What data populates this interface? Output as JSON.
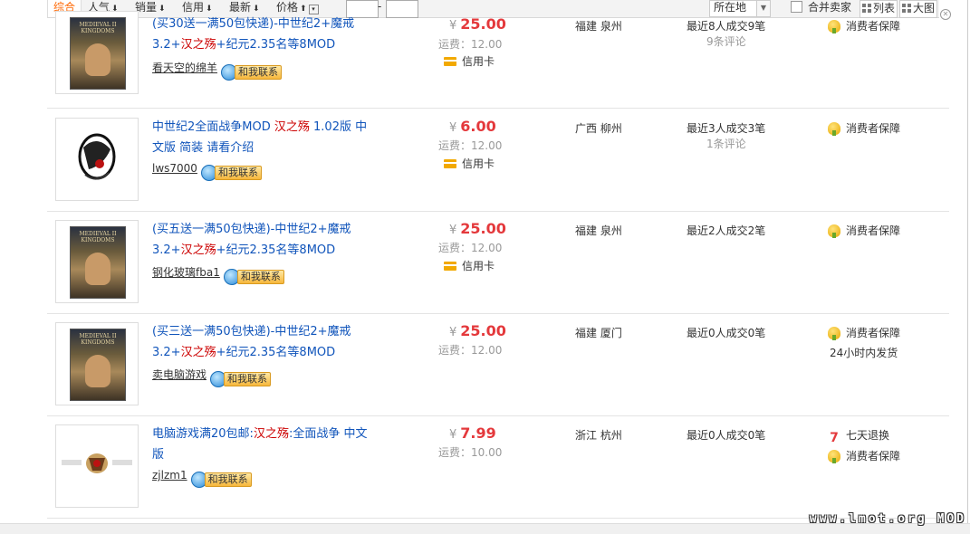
{
  "sortbar": {
    "active": "综合",
    "items": [
      {
        "label": "人气",
        "arrow": "⬇"
      },
      {
        "label": "销量",
        "arrow": "⬇"
      },
      {
        "label": "信用",
        "arrow": "⬇"
      },
      {
        "label": "最新",
        "arrow": "⬇"
      },
      {
        "label": "价格",
        "arrow": "⬆"
      }
    ],
    "price_dash": "-",
    "location_label": "所在地",
    "merge_label": "合并卖家",
    "view_list": "列表",
    "view_grid": "大图"
  },
  "contact_label": "和我联系",
  "price_currency": "¥",
  "listings": [
    {
      "title_parts": [
        {
          "t": "(买30送一满50包快递)-中世纪2+魔戒3.2+",
          "kw": false
        },
        {
          "t": "汉之殇",
          "kw": true
        },
        {
          "t": "+纪元2.35名等8MOD",
          "kw": false
        }
      ],
      "seller": "看天空的绵羊",
      "price": "25.00",
      "shipping": "运费：12.00",
      "payment": "信用卡",
      "location": "福建 泉州",
      "deals": "最近8人成交9笔",
      "reviews": "9条评论",
      "guarantee": "消费者保障",
      "extra": ""
    },
    {
      "title_parts": [
        {
          "t": "中世纪2全面战争MOD ",
          "kw": false
        },
        {
          "t": "汉之殇",
          "kw": true
        },
        {
          "t": " 1.02版 中文版 简装 请看介绍",
          "kw": false
        }
      ],
      "seller": "lws7000",
      "price": "6.00",
      "shipping": "运费：12.00",
      "payment": "信用卡",
      "location": "广西 柳州",
      "deals": "最近3人成交3笔",
      "reviews": "1条评论",
      "guarantee": "消费者保障",
      "extra": ""
    },
    {
      "title_parts": [
        {
          "t": "(买五送一满50包快递)-中世纪2+魔戒3.2+",
          "kw": false
        },
        {
          "t": "汉之殇",
          "kw": true
        },
        {
          "t": "+纪元2.35名等8MOD",
          "kw": false
        }
      ],
      "seller": "钢化玻璃fba1",
      "price": "25.00",
      "shipping": "运费：12.00",
      "payment": "信用卡",
      "location": "福建 泉州",
      "deals": "最近2人成交2笔",
      "reviews": "",
      "guarantee": "消费者保障",
      "extra": ""
    },
    {
      "title_parts": [
        {
          "t": "(买三送一满50包快递)-中世纪2+魔戒3.2+",
          "kw": false
        },
        {
          "t": "汉之殇",
          "kw": true
        },
        {
          "t": "+纪元2.35名等8MOD",
          "kw": false
        }
      ],
      "seller": "卖电脑游戏",
      "price": "25.00",
      "shipping": "运费：12.00",
      "payment": "",
      "location": "福建 厦门",
      "deals": "最近0人成交0笔",
      "reviews": "",
      "guarantee": "消费者保障",
      "extra": "24小时内发货"
    },
    {
      "title_parts": [
        {
          "t": "电脑游戏满20包邮:",
          "kw": false
        },
        {
          "t": "汉之殇",
          "kw": true
        },
        {
          "t": ":全面战争 中文版",
          "kw": false
        }
      ],
      "seller": "zjlzm1",
      "price": "7.99",
      "shipping": "运费：10.00",
      "payment": "",
      "location": "浙江 杭州",
      "deals": "最近0人成交0笔",
      "reviews": "",
      "guarantee": "七天退换",
      "guarantee2": "消费者保障",
      "extra": ""
    }
  ],
  "cover_text": "MEDIEVAL II KINGDOMS",
  "watermark": "www.lmot.org MOD",
  "colors": {
    "link": "#1155bb",
    "keyword": "#cc0000",
    "price": "#e4393c",
    "active_sort": "#ff6600"
  }
}
